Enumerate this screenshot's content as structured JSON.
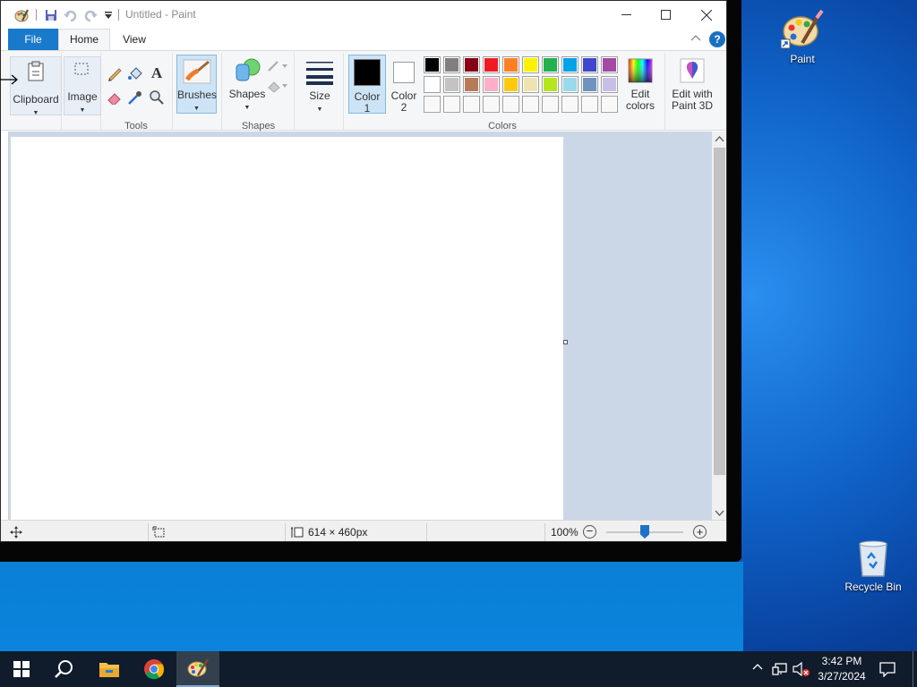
{
  "window": {
    "title": "Untitled - Paint",
    "tabs": {
      "file": "File",
      "home": "Home",
      "view": "View"
    }
  },
  "ribbon": {
    "clipboard": "Clipboard",
    "image": "Image",
    "tools_label": "Tools",
    "brushes": "Brushes",
    "shapes": "Shapes",
    "shapes_label": "Shapes",
    "size": "Size",
    "color1": "Color\n1",
    "color2": "Color\n2",
    "colors_label": "Colors",
    "edit_colors": "Edit\ncolors",
    "edit_paint3d": "Edit with\nPaint 3D",
    "color1_value": "#000000",
    "color2_value": "#ffffff",
    "palette": [
      [
        "#000000",
        "#7f7f7f",
        "#880015",
        "#ed1c24",
        "#ff7f27",
        "#fff200",
        "#22b14c",
        "#00a2e8",
        "#3f48cc",
        "#a349a4"
      ],
      [
        "#ffffff",
        "#c3c3c3",
        "#b97a57",
        "#ffaec9",
        "#ffc90e",
        "#efe4b0",
        "#b5e61d",
        "#99d9ea",
        "#7092be",
        "#c8bfe7"
      ],
      [
        "#f8f8f8",
        "#f8f8f8",
        "#f8f8f8",
        "#f8f8f8",
        "#f8f8f8",
        "#f8f8f8",
        "#f8f8f8",
        "#f8f8f8",
        "#f8f8f8",
        "#f8f8f8"
      ]
    ]
  },
  "status": {
    "dimensions": "614 × 460px",
    "zoom": "100%"
  },
  "desktop": {
    "paint_icon_label": "Paint",
    "recycle_label": "Recycle Bin"
  },
  "taskbar": {
    "time": "3:42 PM",
    "date": "3/27/2024"
  },
  "icons": [
    "windows-logo-icon",
    "search-icon",
    "file-explorer-icon",
    "chrome-icon",
    "paint-icon",
    "help-icon",
    "volume-muted-icon",
    "network-icon",
    "notification-icon"
  ]
}
